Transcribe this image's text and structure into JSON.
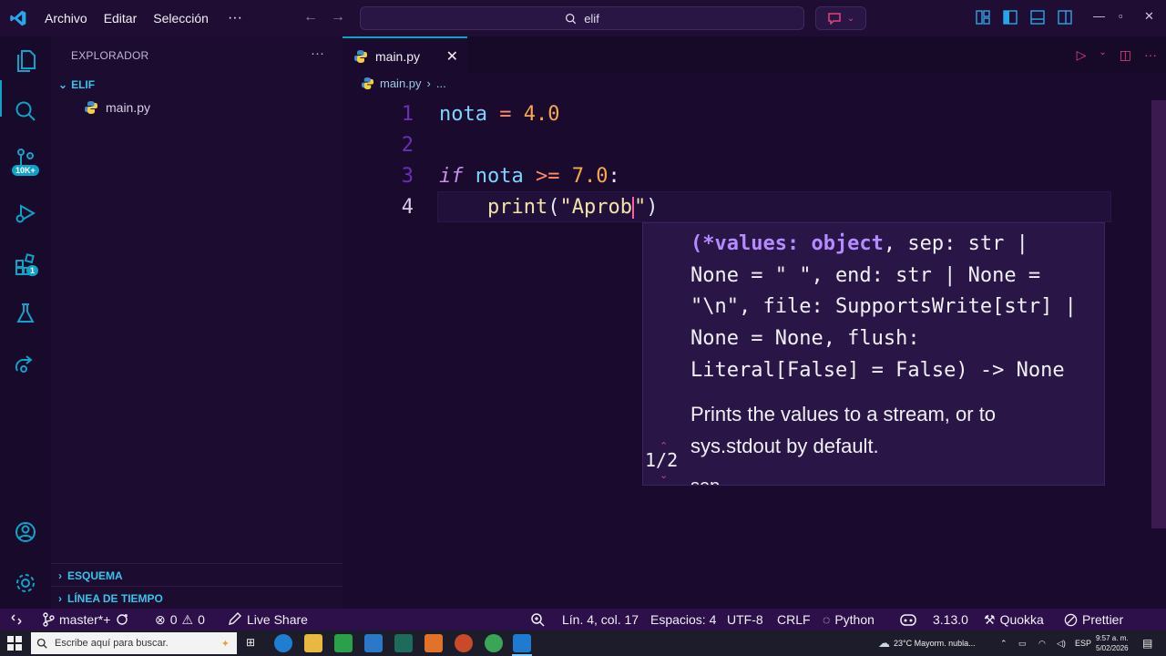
{
  "titlebar": {
    "menu": [
      "Archivo",
      "Editar",
      "Selección"
    ],
    "more": "···",
    "search_text": "elif",
    "window_controls": [
      "—",
      "▫",
      "✕"
    ]
  },
  "activitybar": {
    "icons": [
      "files-icon",
      "search-icon",
      "source-control-icon",
      "run-debug-icon",
      "extensions-icon",
      "testing-icon",
      "live-share-icon"
    ],
    "source_control_badge": "10K+",
    "extensions_badge": "1"
  },
  "sidebar": {
    "title": "EXPLORADOR",
    "more": "···",
    "folder": "ELIF",
    "files": [
      "main.py"
    ],
    "sections": [
      "ESQUEMA",
      "LÍNEA DE TIEMPO"
    ]
  },
  "editor": {
    "tab_label": "main.py",
    "breadcrumb": [
      "main.py",
      "..."
    ],
    "line_numbers": [
      "1",
      "2",
      "3",
      "4"
    ],
    "code": {
      "l1": {
        "var": "nota",
        "op": " = ",
        "num": "4.0"
      },
      "l3": {
        "kw": "if",
        "var": " nota",
        "op": " >= ",
        "num": "7.0",
        "punc": ":"
      },
      "l4": {
        "indent": "    ",
        "fn": "print",
        "open": "(",
        "str": "\"Aprob",
        "close_quote": "\"",
        "close": ")"
      }
    }
  },
  "hover": {
    "sig_line1_hl": "(*values: object",
    "sig_line1_rest": ", sep: str |",
    "sig_line2": "None = \" \", end: str | None =",
    "sig_line3": "\"\\n\", file: SupportsWrite[str] |",
    "sig_line4": "None = None, flush:",
    "sig_line5": "Literal[False] = False) -> None",
    "doc_line1": "Prints the values to a stream, or to",
    "doc_line2": "sys.stdout by default.",
    "page": "1/2",
    "more": "sep"
  },
  "statusbar": {
    "branch": "master*+",
    "errors": "0",
    "warnings": "0",
    "live_share": "Live Share",
    "position": "Lín. 4, col. 17",
    "spaces": "Espacios: 4",
    "encoding": "UTF-8",
    "eol": "CRLF",
    "language": "Python",
    "version": "3.13.0",
    "quokka": "Quokka",
    "prettier": "Prettier"
  },
  "taskbar": {
    "search_placeholder": "Escribe aquí para buscar.",
    "weather": "23°C  Mayorm. nubla...",
    "lang": "ESP",
    "time": "9:57 a. m.",
    "date": "5/02/2026"
  },
  "colors": {
    "accent": "#0fa3c8",
    "background": "#1a0b2e",
    "statusbar": "#2d0f49",
    "hover_bg": "#2a1547"
  }
}
